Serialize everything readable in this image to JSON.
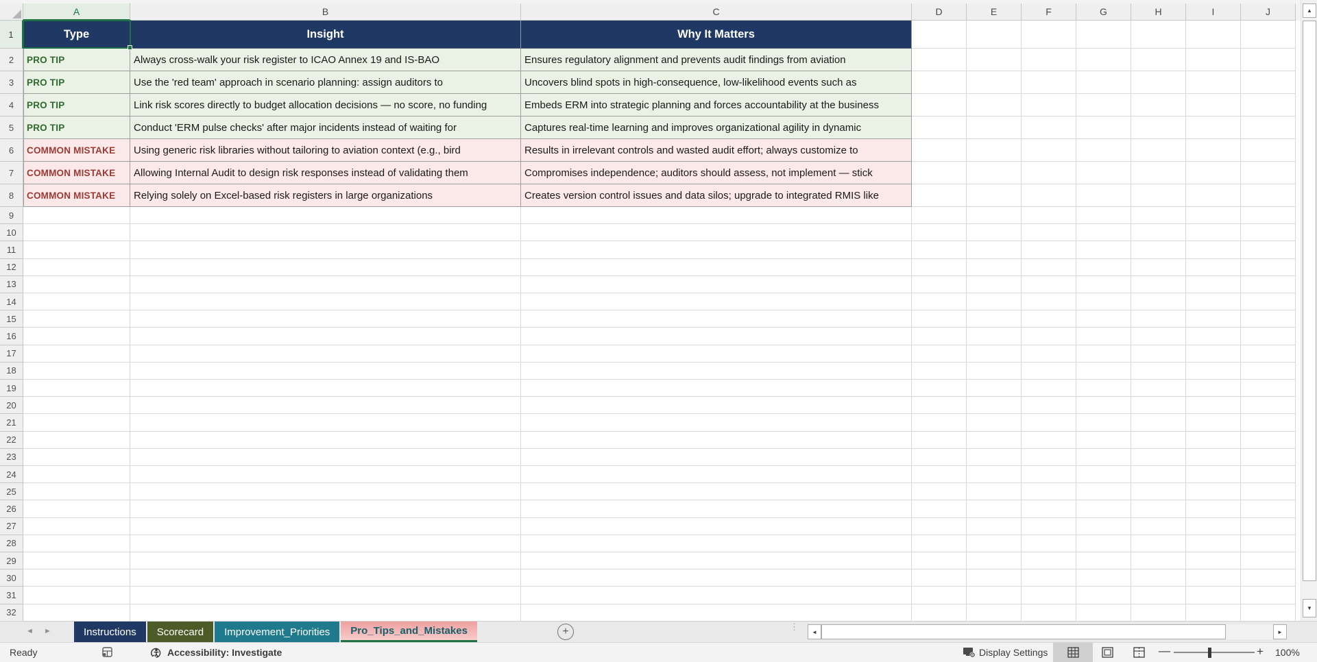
{
  "sheet": {
    "column_letters": [
      "A",
      "B",
      "C",
      "D",
      "E",
      "F",
      "G",
      "H",
      "I",
      "J"
    ],
    "row_count": 32,
    "selected_cell": "A1",
    "table": {
      "headers": [
        "Type",
        "Insight",
        "Why It Matters"
      ],
      "rows": [
        {
          "kind": "tip",
          "type": "PRO TIP",
          "insight": "Always cross-walk your risk register to ICAO Annex 19 and IS-BAO",
          "why": "Ensures regulatory alignment and prevents audit findings from aviation"
        },
        {
          "kind": "tip",
          "type": "PRO TIP",
          "insight": "Use the 'red team' approach in scenario planning: assign auditors to",
          "why": "Uncovers blind spots in high-consequence, low-likelihood events such as"
        },
        {
          "kind": "tip",
          "type": "PRO TIP",
          "insight": "Link risk scores directly to budget allocation decisions — no score, no funding",
          "why": "Embeds ERM into strategic planning and forces accountability at the business"
        },
        {
          "kind": "tip",
          "type": "PRO TIP",
          "insight": "Conduct 'ERM pulse checks' after major incidents instead of waiting for",
          "why": "Captures real-time learning and improves organizational agility in dynamic"
        },
        {
          "kind": "mistake",
          "type": "COMMON MISTAKE",
          "insight": "Using generic risk libraries without tailoring to aviation context (e.g., bird",
          "why": "Results in irrelevant controls and wasted audit effort; always customize to"
        },
        {
          "kind": "mistake",
          "type": "COMMON MISTAKE",
          "insight": "Allowing Internal Audit to design risk responses instead of validating them",
          "why": "Compromises independence; auditors should assess, not implement — stick"
        },
        {
          "kind": "mistake",
          "type": "COMMON MISTAKE",
          "insight": "Relying solely on Excel-based risk registers in large organizations",
          "why": "Creates version control issues and data silos; upgrade to integrated RMIS like"
        }
      ]
    }
  },
  "sheet_tabs": [
    {
      "label": "Instructions",
      "color": "#1F3864",
      "active": false
    },
    {
      "label": "Scorecard",
      "color": "#4D5B28",
      "active": false
    },
    {
      "label": "Improvement_Priorities",
      "color": "#1E7A8C",
      "active": false
    },
    {
      "label": "Pro_Tips_and_Mistakes",
      "color": "#F4ABAB",
      "active": true
    }
  ],
  "tab_bar": {
    "new_sheet_label": "+",
    "nav_left": "◄",
    "nav_right": "►",
    "overflow_dots": "⋮"
  },
  "scrollbars": {
    "up": "▲",
    "down": "▼",
    "left": "◄",
    "right": "►"
  },
  "status_bar": {
    "mode": "Ready",
    "accessibility": "Accessibility: Investigate",
    "display_settings": "Display Settings",
    "zoom_minus": "—",
    "zoom_plus": "+",
    "zoom_level": "100%"
  },
  "colors": {
    "header_bg": "#1F3864",
    "tip_bg": "#E9F2E4",
    "tip_text": "#2F672F",
    "mistake_bg": "#FBE9E9",
    "mistake_text": "#9C3A34",
    "selection_green": "#1E7145"
  }
}
